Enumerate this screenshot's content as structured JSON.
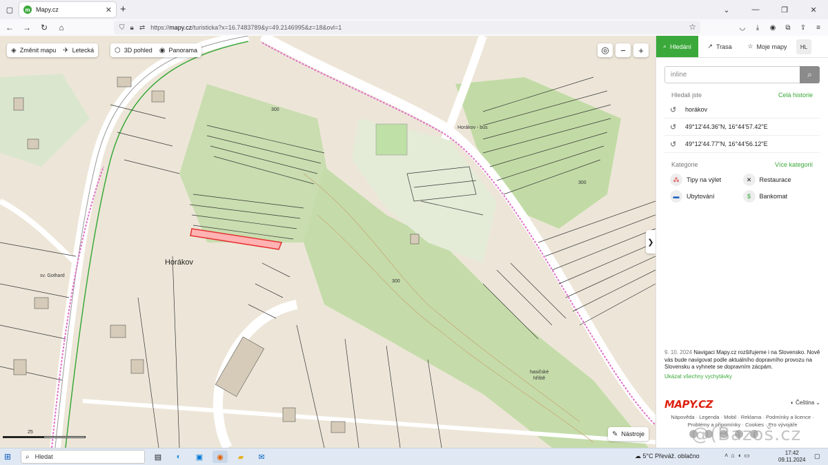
{
  "browser": {
    "tab_title": "Mapy.cz",
    "tab_favicon": "mapy-favicon-icon",
    "url_prefix": "https://",
    "url_domain": "mapy.cz",
    "url_path": "/turisticka?x=16.7483789&y=49.2146995&z=18&ovl=1"
  },
  "map": {
    "buttons": {
      "change_map": "Změnit mapu",
      "aerial": "Letecká",
      "view3d": "3D pohled",
      "panorama": "Panorama",
      "tools": "Nástroje"
    },
    "labels": {
      "village": "Horákov",
      "bus_stop": "Horákov - bus",
      "fire_field_line1": "hasičské",
      "fire_field_line2": "hřiště",
      "gothard": "sv. Gothard",
      "contour_300_a": "300",
      "contour_300_b": "300",
      "contour_300_c": "300"
    },
    "scale_text": "25",
    "accent_color": "#3aa83a",
    "highlight_color": "#e63030"
  },
  "panel": {
    "tabs": {
      "search": "Hledání",
      "route": "Trasa",
      "my_maps": "Moje mapy",
      "user": "HL"
    },
    "search": {
      "placeholder": "inline"
    },
    "history": {
      "title": "Hledali jste",
      "all_link": "Celá historie",
      "items": [
        "horákov",
        "49°12'44.36\"N, 16°44'57.42\"E",
        "49°12'44.77\"N, 16°44'56.12\"E"
      ]
    },
    "categories": {
      "title": "Kategorie",
      "more_link": "Více kategorií",
      "items": [
        {
          "label": "Tipy na výlet",
          "icon": "trip-icon"
        },
        {
          "label": "Restaurace",
          "icon": "restaurant-icon"
        },
        {
          "label": "Ubytování",
          "icon": "bed-icon"
        },
        {
          "label": "Bankomat",
          "icon": "atm-icon"
        }
      ]
    },
    "news": {
      "date": "9. 10. 2024",
      "text": "Navigaci Mapy.cz rozšiřujeme i na Slovensko. Nově vás bude navigovat podle aktuálního dopravního provozu na Slovensku a vyhnete se dopravním zácpám.",
      "link": "Ukázat všechny vychytávky"
    },
    "footer": {
      "logo": "MAPY.CZ",
      "language": "Čeština",
      "links_line1": "Nápověda · Legenda · Mobil · Reklama · Podmínky a licence ·",
      "links_line2": "Problémy a připomínky · Cookies · Pro vývojáře"
    }
  },
  "taskbar": {
    "search_label": "Hledat",
    "weather_temp": "5°C",
    "weather_text": "Převáž. oblačno",
    "time": "17:42",
    "date": "09.11.2024"
  },
  "watermark": "@(Bazoš.cz"
}
